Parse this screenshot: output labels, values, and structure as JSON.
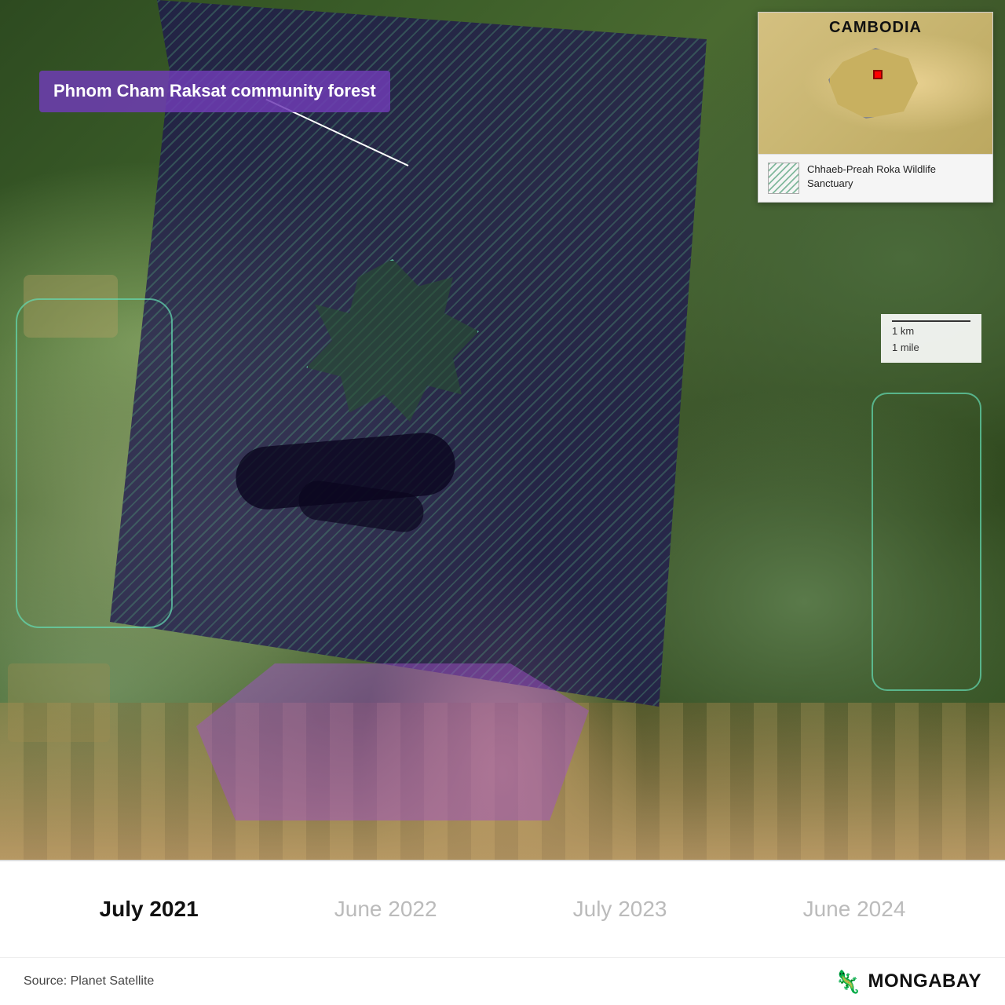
{
  "map": {
    "title": "Phnom Cham Raksat community forest",
    "country": "CAMBODIA",
    "legend": {
      "label": "Chhaeb-Preah Roka Wildlife Sanctuary"
    },
    "scale": {
      "km": "1 km",
      "mile": "1 mile"
    }
  },
  "timeline": {
    "items": [
      {
        "label": "July 2021",
        "active": true
      },
      {
        "label": "June 2022",
        "active": false
      },
      {
        "label": "July 2023",
        "active": false
      },
      {
        "label": "June 2024",
        "active": false
      }
    ]
  },
  "footer": {
    "source": "Source: Planet Satellite",
    "brand": "MONGABAY"
  }
}
